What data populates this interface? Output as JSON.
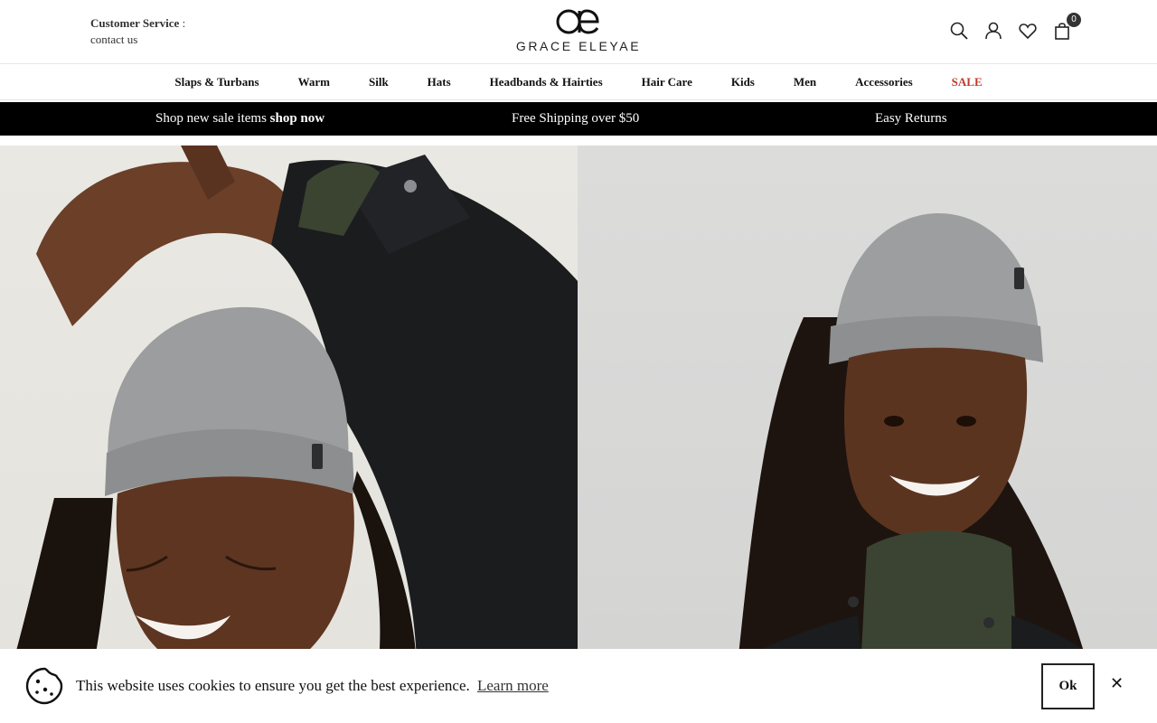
{
  "header": {
    "customer_service_label": "Customer Service",
    "customer_service_colon": ":",
    "contact_link": "contact us",
    "logo_text": "GRACE ELEYAE",
    "cart_count": "0"
  },
  "nav": {
    "items": [
      {
        "label": "Slaps & Turbans"
      },
      {
        "label": "Warm"
      },
      {
        "label": "Silk"
      },
      {
        "label": "Hats"
      },
      {
        "label": "Headbands & Hairties"
      },
      {
        "label": "Hair Care"
      },
      {
        "label": "Kids"
      },
      {
        "label": "Men"
      },
      {
        "label": "Accessories"
      },
      {
        "label": "SALE"
      }
    ]
  },
  "promo": {
    "item1_text": "Shop new sale items",
    "item1_link": "shop now",
    "item2": "Free Shipping over $50",
    "item3": "Easy Returns"
  },
  "cookie": {
    "message": "This website uses cookies to ensure you get the best experience.",
    "learn_more": "Learn more",
    "ok_label": "Ok",
    "close_label": "✕"
  },
  "icons": {
    "search": "search-icon",
    "account": "user-icon",
    "wishlist": "heart-icon",
    "cart": "shopping-bag-icon",
    "cookie": "cookie-icon"
  },
  "colors": {
    "promo_bg": "#000000",
    "sale": "#c0392b"
  }
}
